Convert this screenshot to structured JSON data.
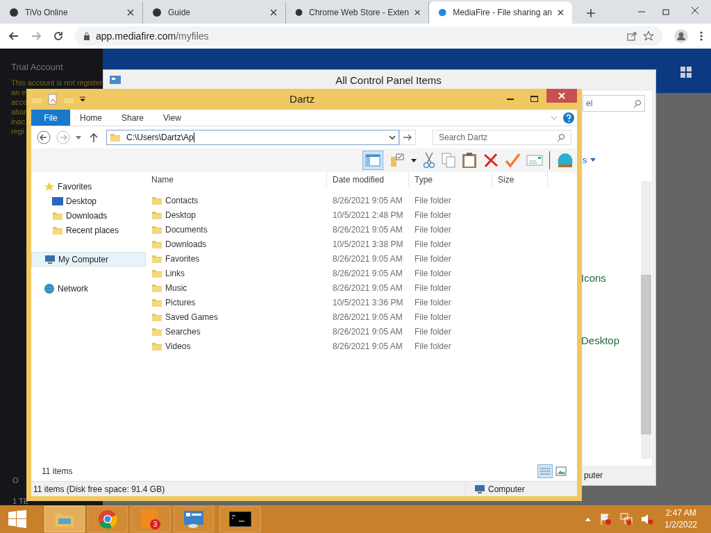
{
  "browser": {
    "tabs": [
      {
        "title": "TiVo Online",
        "selected": false
      },
      {
        "title": "Guide",
        "selected": false
      },
      {
        "title": "Chrome Web Store - Exten",
        "selected": false
      },
      {
        "title": "MediaFire - File sharing an",
        "selected": true
      }
    ],
    "url_host": "app.mediafire.com",
    "url_path": "/myfiles"
  },
  "mediafire": {
    "account_title": "Trial Account",
    "notice_lines": [
      "This account is not register",
      "an e",
      "acco",
      "aban",
      "inac",
      "regi"
    ],
    "footer_lines": [
      "O",
      "1 TE"
    ]
  },
  "control_panel": {
    "title": "All Control Panel Items",
    "search_placeholder": "el",
    "view_link": "s",
    "items": [
      "Icons",
      "Desktop"
    ],
    "status": "puter"
  },
  "explorer": {
    "title": "Dartz",
    "ribbon_tabs": [
      {
        "label": "File",
        "selected": true
      },
      {
        "label": "Home",
        "selected": false
      },
      {
        "label": "Share",
        "selected": false
      },
      {
        "label": "View",
        "selected": false
      }
    ],
    "address": "C:\\Users\\Dartz\\Ap",
    "search_placeholder": "Search Dartz",
    "nav": [
      {
        "label": "Favorites",
        "selected": false,
        "children": [
          {
            "label": "Desktop",
            "selected": false
          },
          {
            "label": "Downloads",
            "selected": false
          },
          {
            "label": "Recent places",
            "selected": false
          }
        ]
      },
      {
        "label": "My Computer",
        "selected": true
      },
      {
        "label": "Network",
        "selected": false
      }
    ],
    "columns": [
      "Name",
      "Date modified",
      "Type",
      "Size"
    ],
    "rows": [
      {
        "name": "Contacts",
        "date": "8/26/2021 9:05 AM",
        "type": "File folder"
      },
      {
        "name": "Desktop",
        "date": "10/5/2021 2:48 PM",
        "type": "File folder"
      },
      {
        "name": "Documents",
        "date": "8/26/2021 9:05 AM",
        "type": "File folder"
      },
      {
        "name": "Downloads",
        "date": "10/5/2021 3:38 PM",
        "type": "File folder"
      },
      {
        "name": "Favorites",
        "date": "8/26/2021 9:05 AM",
        "type": "File folder"
      },
      {
        "name": "Links",
        "date": "8/26/2021 9:05 AM",
        "type": "File folder"
      },
      {
        "name": "Music",
        "date": "8/26/2021 9:05 AM",
        "type": "File folder"
      },
      {
        "name": "Pictures",
        "date": "10/5/2021 3:36 PM",
        "type": "File folder"
      },
      {
        "name": "Saved Games",
        "date": "8/26/2021 9:05 AM",
        "type": "File folder"
      },
      {
        "name": "Searches",
        "date": "8/26/2021 9:05 AM",
        "type": "File folder"
      },
      {
        "name": "Videos",
        "date": "8/26/2021 9:05 AM",
        "type": "File folder"
      }
    ],
    "item_count": "11 items",
    "status_text": "11 items (Disk free space: 91.4 GB)",
    "status_location": "Computer"
  },
  "taskbar": {
    "apps": [
      {
        "kind": "explorer",
        "selected": true
      },
      {
        "kind": "chrome",
        "selected": false
      },
      {
        "kind": "dbadge",
        "selected": false,
        "badge": "3"
      },
      {
        "kind": "controlpanel",
        "selected": false
      },
      {
        "kind": "cmd",
        "selected": false
      }
    ],
    "time": "2:47 AM",
    "date": "1/2/2022"
  }
}
